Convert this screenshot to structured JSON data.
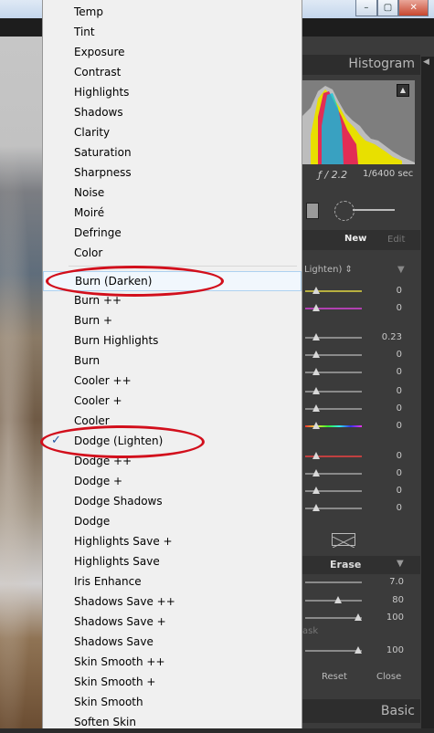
{
  "window": {
    "buttons": {
      "minimize": "–",
      "maximize": "▢",
      "close": "✕"
    }
  },
  "panel": {
    "histogram_title": "Histogram",
    "histogram_arrow": "◀",
    "clip_icon": "▲",
    "aperture": "ƒ / 2.2",
    "shutter": "1/6400 sec",
    "mask": {
      "new": "New",
      "edit": "Edit"
    },
    "effect_value": "Lighten) ⇕",
    "effect_arrow": "▼",
    "sliders_a": [
      "0",
      "0"
    ],
    "sliders_b": [
      "0.23",
      "0",
      "0",
      "0",
      "0",
      "0"
    ],
    "sliders_c": [
      "0",
      "0",
      "0",
      "0"
    ],
    "brush": {
      "erase": "Erase",
      "arrow": "▼",
      "size": "7.0",
      "feather": "80",
      "flow": "100",
      "ask_label": "ask",
      "density": "100"
    },
    "reset": "Reset",
    "close": "Close",
    "basic_title": "Basic",
    "basic_arrow": "◀"
  },
  "menu": {
    "items": [
      "Temp",
      "Tint",
      "Exposure",
      "Contrast",
      "Highlights",
      "Shadows",
      "Clarity",
      "Saturation",
      "Sharpness",
      "Noise",
      "Moiré",
      "Defringe",
      "Color",
      "Burn (Darken)",
      "Burn ++",
      "Burn +",
      "Burn Highlights",
      "Burn",
      "Cooler ++",
      "Cooler +",
      "Cooler",
      "Dodge (Lighten)",
      "Dodge ++",
      "Dodge +",
      "Dodge Shadows",
      "Dodge",
      "Highlights Save +",
      "Highlights Save",
      "Iris Enhance",
      "Shadows Save ++",
      "Shadows Save +",
      "Shadows Save",
      "Skin Smooth ++",
      "Skin Smooth +",
      "Skin Smooth",
      "Soften Skin"
    ],
    "highlighted": "Burn (Darken)",
    "selected": "Dodge (Lighten)",
    "check_mark": "✓"
  },
  "colors": {
    "annotation": "#d20f1c",
    "menu_bg": "#f0f0f0",
    "check": "#2154a3"
  }
}
